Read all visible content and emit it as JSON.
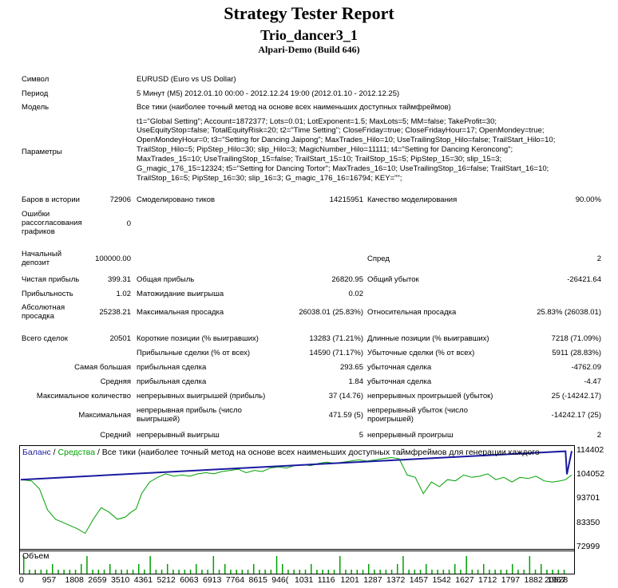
{
  "header": {
    "title": "Strategy Tester Report",
    "subtitle": "Trio_dancer3_1",
    "build": "Alpari-Demo (Build 646)"
  },
  "info": {
    "symbol_label": "Символ",
    "symbol_value": "EURUSD (Euro vs US Dollar)",
    "period_label": "Период",
    "period_value": "5 Минут (M5) 2012.01.10 00:00 - 2012.12.24 19:00 (2012.01.10 - 2012.12.25)",
    "model_label": "Модель",
    "model_value": "Все тики (наиболее точный метод на основе всех наименьших доступных таймфреймов)",
    "params_label": "Параметры",
    "params_lines": [
      "t1=\"Global Setting\"; Account=1872377; Lots=0.01; LotExponent=1.5; MaxLots=5; MM=false; TakeProfit=30;",
      "UseEquityStop=false; TotalEquityRisk=20; t2=\"Time Setting\"; CloseFriday=true; CloseFridayHour=17; OpenMondey=true;",
      "OpenMondeyHour=0; t3=\"Setting for Dancing Jaipong\"; MaxTrades_Hilo=10; UseTrailingStop_Hilo=false; TrailStart_Hilo=10;",
      "TrailStop_Hilo=5; PipStep_Hilo=30; slip_Hilo=3; MagicNumber_Hilo=11111; t4=\"Setting for Dancing Keroncong\";",
      "MaxTrades_15=10; UseTrailingStop_15=false; TrailStart_15=10; TrailStop_15=5; PipStep_15=30; slip_15=3;",
      "G_magic_176_15=12324; t5=\"Setting for Dancing Tortor\"; MaxTrades_16=10; UseTrailingStop_16=false; TrailStart_16=10;",
      "TrailStop_16=5; PipStep_16=30; slip_16=3; G_magic_176_16=16794; KEY=\"\";"
    ]
  },
  "stats": {
    "bars_label": "Баров в истории",
    "bars_value": "72906",
    "ticks_label": "Смоделировано тиков",
    "ticks_value": "14215951",
    "quality_label": "Качество моделирования",
    "quality_value": "90.00%",
    "errors_label": "Ошибки рассогласования графиков",
    "errors_value": "0",
    "deposit_label": "Начальный депозит",
    "deposit_value": "100000.00",
    "spread_label": "Спред",
    "spread_value": "2",
    "net_label": "Чистая прибыль",
    "net_value": "399.31",
    "gross_profit_label": "Общая прибыль",
    "gross_profit_value": "26820.95",
    "gross_loss_label": "Общий убыток",
    "gross_loss_value": "-26421.64",
    "pf_label": "Прибыльность",
    "pf_value": "1.02",
    "payoff_label": "Матожидание выигрыша",
    "payoff_value": "0.02",
    "abs_dd_label": "Абсолютная просадка",
    "abs_dd_value": "25238.21",
    "max_dd_label": "Максимальная просадка",
    "max_dd_value": "26038.01 (25.83%)",
    "rel_dd_label": "Относительная просадка",
    "rel_dd_value": "25.83% (26038.01)",
    "total_label": "Всего сделок",
    "total_value": "20501",
    "short_label": "Короткие позиции (% выигравших)",
    "short_value": "13283 (71.21%)",
    "long_label": "Длинные позиции (% выигравших)",
    "long_value": "7218 (71.09%)",
    "prof_trades_label": "Прибыльные сделки (% от всех)",
    "prof_trades_value": "14590 (71.17%)",
    "loss_trades_label": "Убыточные сделки (% от всех)",
    "loss_trades_value": "5911 (28.83%)",
    "largest_label": "Самая большая",
    "largest_prof_label": "прибыльная сделка",
    "largest_prof_value": "293.65",
    "largest_loss_label": "убыточная сделка",
    "largest_loss_value": "-4762.09",
    "avg_label": "Средняя",
    "avg_prof_label": "прибыльная сделка",
    "avg_prof_value": "1.84",
    "avg_loss_label": "убыточная сделка",
    "avg_loss_value": "-4.47",
    "maxcount_label": "Максимальное количество",
    "maxcount_wins_label": "непрерывных выигрышей (прибыль)",
    "maxcount_wins_value": "37 (14.76)",
    "maxcount_losses_label": "непрерывных проигрышей (убыток)",
    "maxcount_losses_value": "25 (-14242.17)",
    "max_label": "Максимальная",
    "max_profit_label": "непрерывная прибыль (число выигрышей)",
    "max_profit_value": "471.59 (5)",
    "max_loss_label": "непрерывный убыток (число проигрышей)",
    "max_loss_value": "-14242.17 (25)",
    "avg2_label": "Средний",
    "avg_wins_label": "непрерывный выигрыш",
    "avg_wins_value": "5",
    "avg_losses_label": "непрерывный проигрыш",
    "avg_losses_value": "2"
  },
  "chart_legend": {
    "balance": "Баланс",
    "sep": " / ",
    "equity": "Средства",
    "rest": " / Все тики (наиболее точный метод на основе всех наименьших доступных таймфреймов для генерации каждого"
  },
  "colors": {
    "balance": "#1a1aa0",
    "equity": "#00a000",
    "volume": "#00a000"
  },
  "volume_label": "Объем",
  "chart_data": {
    "type": "line",
    "y_ticks": [
      "114402",
      "104052",
      "93701",
      "83350",
      "72999"
    ],
    "ylim": [
      72999,
      114402
    ],
    "x_ticks": [
      "0",
      "957",
      "1808",
      "2659",
      "3510",
      "4361",
      "5212",
      "6063",
      "6913",
      "7764",
      "8615",
      "946(",
      "1031",
      "1116",
      "1201",
      "1287",
      "1372",
      "1457",
      "1542",
      "1627",
      "1712",
      "1797",
      "1882",
      "1967",
      "20528"
    ],
    "xlim": [
      0,
      20528
    ],
    "series": [
      {
        "name": "Баланс",
        "x": [
          0,
          20300,
          20350,
          20528
        ],
        "y": [
          102000,
          114200,
          104300,
          114300
        ]
      },
      {
        "name": "Средства",
        "x": [
          0,
          400,
          700,
          1000,
          1300,
          1500,
          1800,
          2100,
          2400,
          2700,
          3000,
          3300,
          3600,
          3900,
          4100,
          4300,
          4500,
          4800,
          5100,
          5400,
          5700,
          6000,
          6300,
          6600,
          6900,
          7200,
          7500,
          7800,
          8100,
          8400,
          8700,
          9000,
          9300,
          9600,
          9900,
          10200,
          10500,
          10800,
          11100,
          11400,
          11700,
          12000,
          12300,
          12600,
          12900,
          13200,
          13500,
          13800,
          14100,
          14400,
          14700,
          15000,
          15300,
          15600,
          15900,
          16200,
          16500,
          16800,
          17100,
          17400,
          17700,
          18000,
          18300,
          18600,
          18900,
          19200,
          19500,
          19800,
          20100,
          20300,
          20528
        ],
        "y": [
          102000,
          101500,
          98000,
          89000,
          85000,
          84000,
          82500,
          81000,
          79000,
          85000,
          90000,
          88000,
          85000,
          86000,
          88000,
          89500,
          96000,
          101000,
          103000,
          104500,
          103500,
          104000,
          103500,
          104500,
          105000,
          104500,
          105500,
          106000,
          106500,
          105000,
          106000,
          105500,
          107000,
          107500,
          107000,
          108000,
          108500,
          108000,
          109000,
          109500,
          109000,
          109500,
          110000,
          110500,
          110000,
          110500,
          111000,
          111500,
          111000,
          104000,
          103000,
          96000,
          101000,
          99000,
          102000,
          101500,
          104000,
          103000,
          103500,
          104500,
          102000,
          103000,
          101000,
          103000,
          102500,
          103500,
          101500,
          101000,
          101500,
          102000,
          104000
        ]
      }
    ],
    "xlabel": "",
    "ylabel": "",
    "grid": false,
    "legend": "top-left"
  }
}
